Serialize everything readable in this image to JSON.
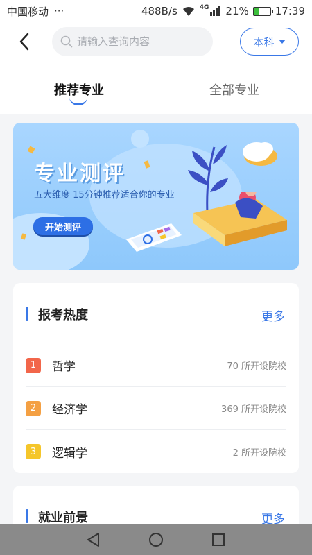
{
  "status_bar": {
    "carrier": "中国移动",
    "dots": "···",
    "speed": "488B/s",
    "network": "4G",
    "battery": "21%",
    "time": "17:39"
  },
  "header": {
    "search_placeholder": "请输入查询内容",
    "level_label": "本科"
  },
  "tabs": [
    {
      "label": "推荐专业",
      "active": true
    },
    {
      "label": "全部专业",
      "active": false
    }
  ],
  "banner": {
    "title": "专业测评",
    "subtitle": "五大维度 15分钟推荐适合你的专业",
    "button_label": "开始测评"
  },
  "hot_section": {
    "title": "报考热度",
    "more_label": "更多",
    "items": [
      {
        "rank": "1",
        "name": "哲学",
        "count": "70 所开设院校"
      },
      {
        "rank": "2",
        "name": "经济学",
        "count": "369 所开设院校"
      },
      {
        "rank": "3",
        "name": "逻辑学",
        "count": "2 所开设院校"
      }
    ]
  },
  "job_section": {
    "title": "就业前景",
    "more_label": "更多"
  },
  "colors": {
    "accent": "#3a78e7",
    "rank1": "#f2664a",
    "rank2": "#f4a043",
    "rank3": "#f5c62a"
  },
  "icons": {
    "back": "chevron-left-icon",
    "search": "search-icon",
    "dropdown": "caret-down-icon",
    "nav_back": "triangle-back-icon",
    "nav_home": "circle-home-icon",
    "nav_recent": "square-recent-icon"
  }
}
